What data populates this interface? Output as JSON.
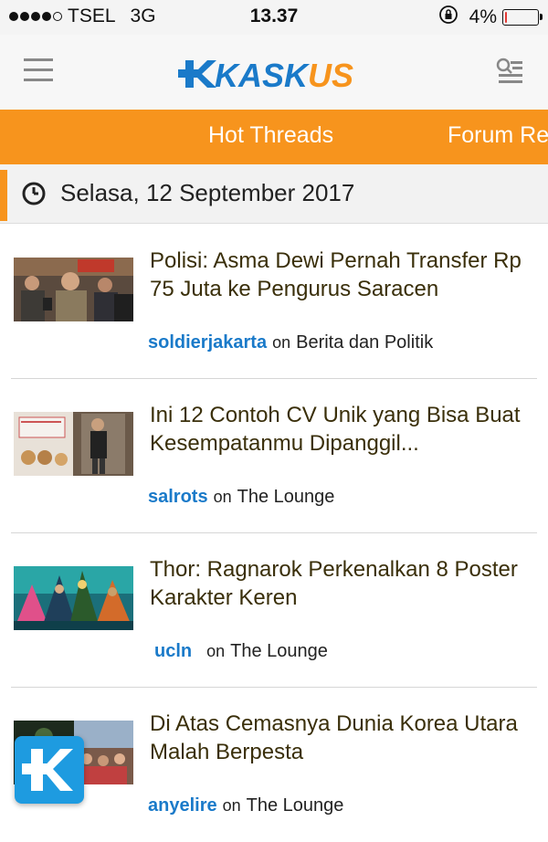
{
  "status_bar": {
    "carrier": "TSEL",
    "network": "3G",
    "time": "13.37",
    "battery_text": "4%",
    "battery_level": 0.04,
    "signal_bars_filled": 4,
    "signal_bars_total": 5
  },
  "header": {
    "logo_text": "KASKUS",
    "menu_icon": "hamburger-menu-icon",
    "search_icon": "search-menu-icon"
  },
  "tabs": [
    {
      "label": "Hot Threads"
    },
    {
      "label": "Forum Re"
    }
  ],
  "date_bar": {
    "icon": "clock-icon",
    "date": "Selasa, 12 September 2017"
  },
  "threads": [
    {
      "title": "Polisi: Asma Dewi Pernah Transfer Rp 75 Juta ke Pengurus Saracen",
      "author": "soldierjakarta",
      "on": "on",
      "forum": "Berita dan Politik"
    },
    {
      "title": "Ini 12 Contoh CV Unik yang Bisa Buat Kesempatanmu Dipanggil...",
      "author": "salrots",
      "on": "on",
      "forum": "The Lounge"
    },
    {
      "title": "Thor: Ragnarok Perkenalkan 8 Poster Karakter Keren",
      "author": "ucln",
      "on": "on",
      "forum": "The Lounge"
    },
    {
      "title": "Di Atas Cemasnya Dunia Korea Utara Malah Berpesta",
      "author": "anyelire",
      "on": "on",
      "forum": "The Lounge"
    }
  ],
  "colors": {
    "accent_orange": "#f7941d",
    "brand_blue": "#1a7ac9",
    "fab_blue": "#1e9be0",
    "battery_red": "#e53935"
  }
}
